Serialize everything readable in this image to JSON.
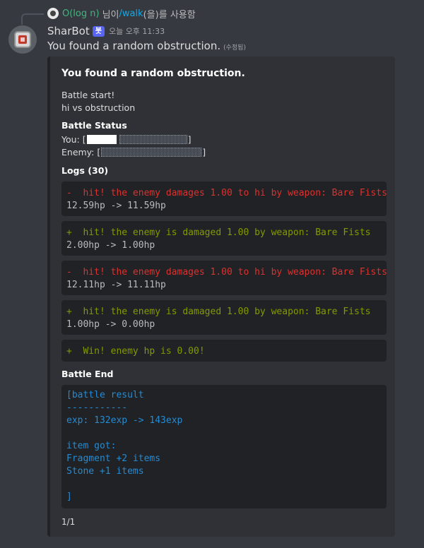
{
  "reply": {
    "user": "O(log n)",
    "text1": "님이 ",
    "command": "/walk",
    "text2": "(을)를 사용함"
  },
  "header": {
    "username": "SharBot",
    "bot_tag": "봇",
    "timestamp": "오늘 오후 11:33"
  },
  "message": {
    "content": "You found a random obstruction.",
    "edited": "(수정됨)"
  },
  "embed": {
    "title": "You found a random obstruction.",
    "desc_line1": "Battle start!",
    "desc_line2": "hi vs obstruction",
    "status_title": "Battle Status",
    "you_label": "You: [",
    "enemy_label": "Enemy: [",
    "bracket_close": "]",
    "you_hp_fraction": 0.3,
    "enemy_hp_fraction": 0.0,
    "logs_title": "Logs (30)",
    "logs": [
      {
        "type": "damage",
        "line1": "-  hit! the enemy damages 1.00 to hi by weapon: Bare Fists",
        "line2": "12.59hp -> 11.59hp"
      },
      {
        "type": "hit",
        "line1": "+  hit! the enemy is damaged 1.00 by weapon: Bare Fists",
        "line2": "2.00hp -> 1.00hp"
      },
      {
        "type": "damage",
        "line1": "-  hit! the enemy damages 1.00 to hi by weapon: Bare Fists",
        "line2": "12.11hp -> 11.11hp"
      },
      {
        "type": "hit",
        "line1": "+  hit! the enemy is damaged 1.00 by weapon: Bare Fists",
        "line2": "1.00hp -> 0.00hp"
      },
      {
        "type": "win",
        "line1": "+  Win! enemy hp is 0.00!"
      }
    ],
    "end_title": "Battle End",
    "result": {
      "line1": "[battle result",
      "line2": "-----------",
      "line3": "exp: 132exp -> 143exp",
      "line4": "item got:",
      "line5": "Fragment +2 items",
      "line6": "Stone +1 items",
      "line7": "]"
    },
    "footer": "1/1"
  },
  "colors": {
    "damage": "#dc322f",
    "hit": "#859900",
    "result": "#268bd2",
    "bot_tag": "#5865f2"
  }
}
